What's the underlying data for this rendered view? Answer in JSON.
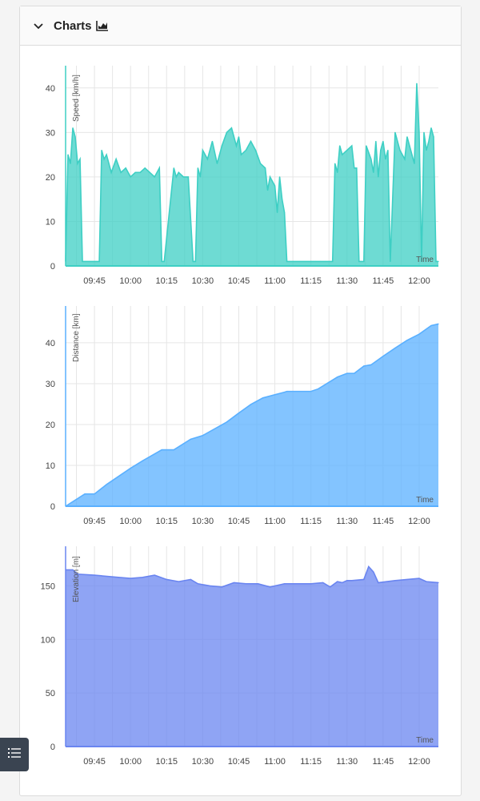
{
  "panel": {
    "title": "Charts",
    "icons": {
      "toggle": "chevron-down-icon",
      "chart": "area-chart-icon"
    }
  },
  "float_button": {
    "icon": "list-icon"
  },
  "colors": {
    "speed": "#3ECFC4",
    "distance": "#5AB0FF",
    "elevation": "#6A85F0"
  },
  "chart_data": [
    {
      "type": "area",
      "ylabel": "Speed [km/h]",
      "xlabel": "Time",
      "xlim": [
        "09:33",
        "12:08"
      ],
      "ylim": [
        0,
        45
      ],
      "yticks": [
        0,
        10,
        20,
        30,
        40
      ],
      "xticks": [
        "09:45",
        "10:00",
        "10:15",
        "10:30",
        "10:45",
        "11:00",
        "11:15",
        "11:30",
        "11:45",
        "12:00"
      ],
      "grid": true,
      "x": [
        "09:33",
        "09:34",
        "09:35",
        "09:36",
        "09:37",
        "09:38",
        "09:39",
        "09:40",
        "09:41",
        "09:47",
        "09:48",
        "09:49",
        "09:50",
        "09:52",
        "09:54",
        "09:56",
        "09:58",
        "10:00",
        "10:02",
        "10:04",
        "10:06",
        "10:08",
        "10:10",
        "10:12",
        "10:13",
        "10:14",
        "10:18",
        "10:19",
        "10:20",
        "10:22",
        "10:24",
        "10:26",
        "10:27",
        "10:28",
        "10:29",
        "10:30",
        "10:32",
        "10:34",
        "10:36",
        "10:38",
        "10:40",
        "10:42",
        "10:44",
        "10:45",
        "10:46",
        "10:48",
        "10:50",
        "10:52",
        "10:54",
        "10:56",
        "10:57",
        "10:58",
        "10:59",
        "11:00",
        "11:01",
        "11:02",
        "11:03",
        "11:04",
        "11:05",
        "11:15",
        "11:16",
        "11:17",
        "11:19",
        "11:21",
        "11:23",
        "11:24",
        "11:25",
        "11:26",
        "11:27",
        "11:28",
        "11:30",
        "11:32",
        "11:33",
        "11:34",
        "11:35",
        "11:36",
        "11:37",
        "11:38",
        "11:40",
        "11:41",
        "11:42",
        "11:43",
        "11:44",
        "11:45",
        "11:46",
        "11:47",
        "11:48",
        "11:50",
        "11:52",
        "11:54",
        "11:55",
        "11:56",
        "11:57",
        "11:58",
        "11:59",
        "12:00",
        "12:01",
        "12:02",
        "12:03",
        "12:04",
        "12:05",
        "12:06",
        "12:07",
        "12:08"
      ],
      "values": [
        1,
        25,
        23,
        31,
        29,
        23,
        24,
        1,
        1,
        1,
        26,
        24,
        25,
        21,
        24,
        21,
        22,
        20,
        21,
        21,
        22,
        21,
        20,
        22,
        1,
        1,
        22,
        20,
        21,
        20,
        20,
        1,
        1,
        22,
        20,
        26,
        24,
        28,
        23,
        27,
        30,
        31,
        27,
        29,
        25,
        26,
        28,
        26,
        23,
        22,
        17,
        20,
        19,
        18,
        12,
        20,
        15,
        12,
        1,
        1,
        1,
        1,
        1,
        1,
        1,
        1,
        23,
        21,
        27,
        25,
        26,
        27,
        22,
        22,
        1,
        1,
        1,
        27,
        24,
        21,
        28,
        20,
        26,
        28,
        24,
        26,
        1,
        30,
        26,
        24,
        29,
        27,
        25,
        23,
        41,
        30,
        1,
        30,
        26,
        28,
        31,
        29,
        1,
        1
      ]
    },
    {
      "type": "area",
      "ylabel": "Distance [km]",
      "xlabel": "Time",
      "xlim": [
        "09:33",
        "12:08"
      ],
      "ylim": [
        0,
        49
      ],
      "yticks": [
        0,
        10,
        20,
        30,
        40
      ],
      "xticks": [
        "09:45",
        "10:00",
        "10:15",
        "10:30",
        "10:45",
        "11:00",
        "11:15",
        "11:30",
        "11:45",
        "12:00"
      ],
      "grid": true,
      "x": [
        "09:33",
        "09:41",
        "09:45",
        "09:50",
        "10:00",
        "10:05",
        "10:13",
        "10:18",
        "10:25",
        "10:30",
        "10:40",
        "10:45",
        "10:50",
        "10:55",
        "11:00",
        "11:04",
        "11:05",
        "11:15",
        "11:18",
        "11:26",
        "11:30",
        "11:33",
        "11:37",
        "11:40",
        "11:45",
        "11:50",
        "11:55",
        "12:00",
        "12:05",
        "12:08"
      ],
      "values": [
        0,
        3,
        3,
        5.3,
        9.3,
        11.1,
        13.8,
        13.8,
        16.4,
        17.3,
        20.6,
        22.8,
        24.9,
        26.5,
        27.3,
        27.9,
        28.1,
        28.1,
        28.7,
        31.6,
        32.5,
        32.5,
        34.3,
        34.6,
        36.7,
        38.7,
        40.6,
        42.1,
        44.2,
        44.6
      ]
    },
    {
      "type": "area",
      "ylabel": "Elevation [m]",
      "xlabel": "Time",
      "xlim": [
        "09:33",
        "12:08"
      ],
      "ylim": [
        0,
        187
      ],
      "yticks": [
        0,
        50,
        100,
        150
      ],
      "xticks": [
        "09:45",
        "10:00",
        "10:15",
        "10:30",
        "10:45",
        "11:00",
        "11:15",
        "11:30",
        "11:45",
        "12:00"
      ],
      "grid": true,
      "x": [
        "09:33",
        "09:36",
        "09:38",
        "09:45",
        "09:55",
        "10:00",
        "10:05",
        "10:10",
        "10:15",
        "10:20",
        "10:25",
        "10:28",
        "10:33",
        "10:38",
        "10:43",
        "10:48",
        "10:53",
        "10:58",
        "11:02",
        "11:04",
        "11:15",
        "11:20",
        "11:23",
        "11:26",
        "11:28",
        "11:30",
        "11:32",
        "11:37",
        "11:39",
        "11:41",
        "11:43",
        "11:50",
        "11:55",
        "12:00",
        "12:03",
        "12:08"
      ],
      "values": [
        165,
        165,
        161,
        160,
        158,
        157,
        158,
        160,
        156,
        154,
        156,
        152,
        150,
        149,
        153,
        152,
        152,
        149,
        151,
        152,
        152,
        153,
        149,
        154,
        153,
        155,
        155,
        156,
        168,
        163,
        153,
        155,
        156,
        157,
        154,
        153
      ]
    }
  ]
}
